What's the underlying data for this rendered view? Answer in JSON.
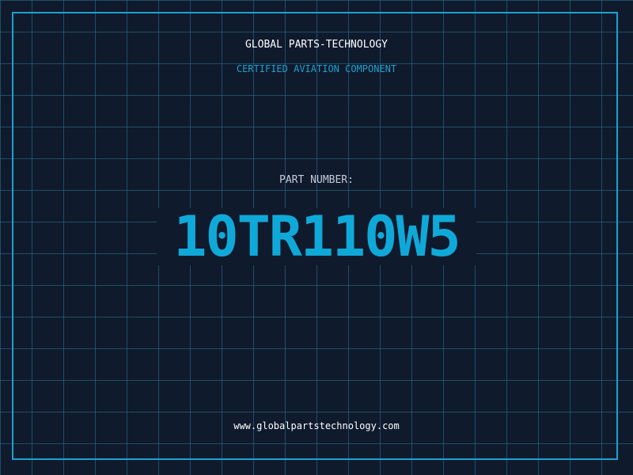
{
  "brand": "GLOBAL PARTS-TECHNOLOGY",
  "tagline": "CERTIFIED AVIATION COMPONENT",
  "part": {
    "label": "PART NUMBER:",
    "number": "10TR110W5"
  },
  "website": "www.globalpartstechnology.com",
  "colors": {
    "background": "#101a2d",
    "grid": "#1f6f8c",
    "accent": "#1aa3cf",
    "text": "#ffffff"
  }
}
